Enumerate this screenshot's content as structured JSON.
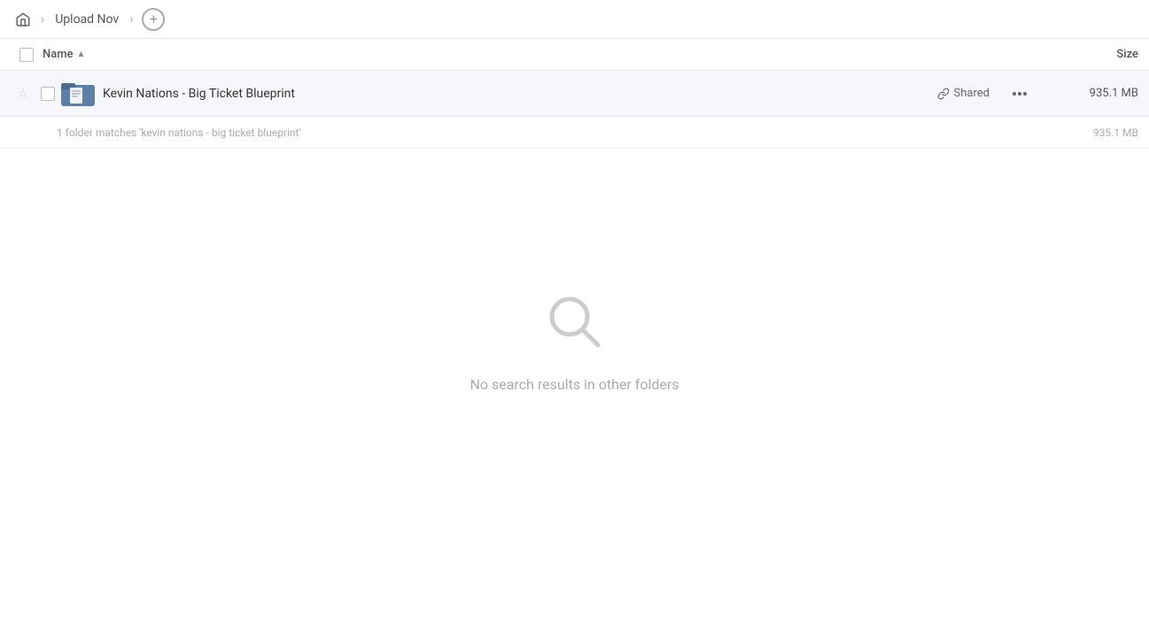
{
  "breadcrumb": {
    "home_label": "Home",
    "items": [
      {
        "label": "Upload Nov"
      }
    ],
    "add_label": "+"
  },
  "columns": {
    "name_label": "Name",
    "sort_arrow": "▲",
    "size_label": "Size"
  },
  "file_row": {
    "name": "Kevin Nations - Big Ticket Blueprint",
    "shared_label": "Shared",
    "size": "935.1 MB",
    "more_icon": "•••"
  },
  "match_info": {
    "text": "1 folder matches 'kevin nations - big ticket blueprint'",
    "size": "935.1 MB"
  },
  "empty_state": {
    "message": "No search results in other folders"
  }
}
